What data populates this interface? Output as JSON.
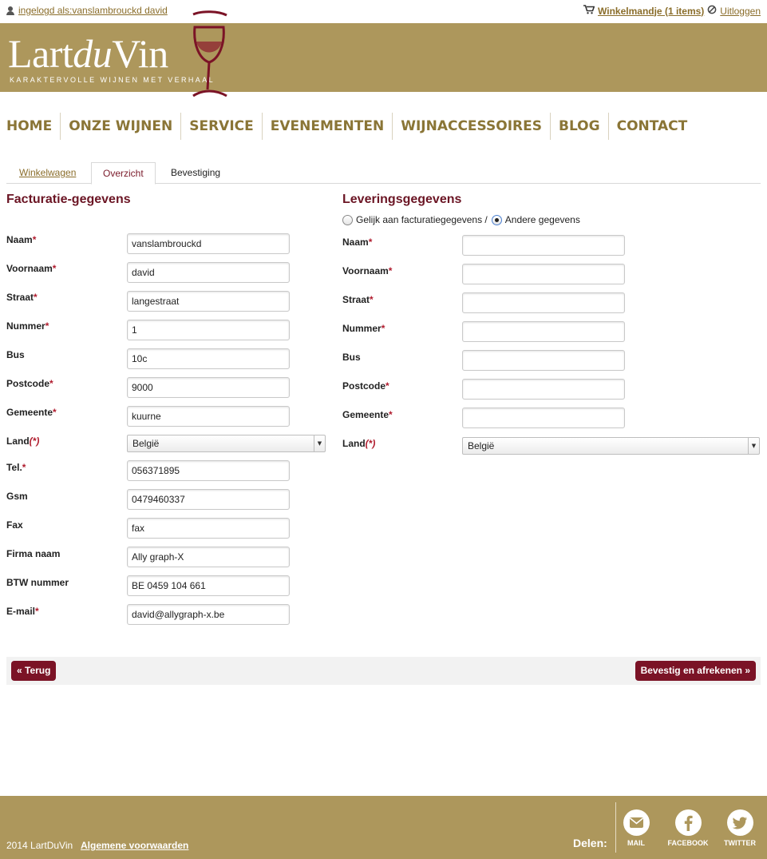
{
  "topbar": {
    "user_label": "ingelogd als:vanslambrouckd david",
    "cart_label": "Winkelmandje (1 items)",
    "logout_label": "Uitloggen"
  },
  "logo": {
    "name_part1": "Lart",
    "name_part2": "du",
    "name_part3": "Vin",
    "tagline": "KARAKTERVOLLE WIJNEN MET VERHAAL"
  },
  "nav": {
    "items": [
      "HOME",
      "ONZE WIJNEN",
      "SERVICE",
      "EVENEMENTEN",
      "WIJNACCESSOIRES",
      "BLOG",
      "CONTACT"
    ]
  },
  "tabs": [
    "Winkelwagen",
    "Overzicht",
    "Bevestiging"
  ],
  "billing": {
    "title": "Facturatie-gegevens",
    "fields": [
      {
        "label": "Naam",
        "required": "*",
        "value": "vanslambrouckd"
      },
      {
        "label": "Voornaam",
        "required": "*",
        "value": "david"
      },
      {
        "label": "Straat",
        "required": "*",
        "value": "langestraat"
      },
      {
        "label": "Nummer",
        "required": "*",
        "value": "1"
      },
      {
        "label": "Bus",
        "required": "",
        "value": "10c"
      },
      {
        "label": "Postcode",
        "required": "*",
        "value": "9000"
      },
      {
        "label": "Gemeente",
        "required": "*",
        "value": "kuurne"
      },
      {
        "label": "Land",
        "required": "(*)",
        "value": "België"
      },
      {
        "label": "Tel.",
        "required": "*",
        "value": "056371895"
      },
      {
        "label": "Gsm",
        "required": "",
        "value": "0479460337"
      },
      {
        "label": "Fax",
        "required": "",
        "value": "fax"
      },
      {
        "label": "Firma naam",
        "required": "",
        "value": "Ally graph-X"
      },
      {
        "label": "BTW nummer",
        "required": "",
        "value": "BE 0459 104 661"
      },
      {
        "label": "E-mail",
        "required": "*",
        "value": "david@allygraph-x.be"
      }
    ]
  },
  "delivery": {
    "title": "Leveringsgegevens",
    "option_same": "Gelijk aan facturatiegegevens /",
    "option_other": "Andere gegevens",
    "selected_option": "Andere gegevens",
    "fields": [
      {
        "label": "Naam",
        "required": "*",
        "value": ""
      },
      {
        "label": "Voornaam",
        "required": "*",
        "value": ""
      },
      {
        "label": "Straat",
        "required": "*",
        "value": ""
      },
      {
        "label": "Nummer",
        "required": "*",
        "value": ""
      },
      {
        "label": "Bus",
        "required": "",
        "value": ""
      },
      {
        "label": "Postcode",
        "required": "*",
        "value": ""
      },
      {
        "label": "Gemeente",
        "required": "*",
        "value": ""
      },
      {
        "label": "Land",
        "required": "(*)",
        "value": "België"
      }
    ]
  },
  "buttons": {
    "back": "« Terug",
    "confirm": "Bevestig en afrekenen »"
  },
  "footer": {
    "copyright": "2014 LartDuVin",
    "terms": "Algemene voorwaarden",
    "share_label": "Delen:",
    "share": [
      {
        "label": "MAIL",
        "icon": "mail-icon"
      },
      {
        "label": "FACEBOOK",
        "icon": "facebook-icon"
      },
      {
        "label": "TWITTER",
        "icon": "twitter-icon"
      }
    ]
  },
  "colors": {
    "brand_gold": "#ad975c",
    "brand_wine": "#7b1326",
    "nav_text": "#8a7536",
    "title_wine": "#6b1524"
  }
}
